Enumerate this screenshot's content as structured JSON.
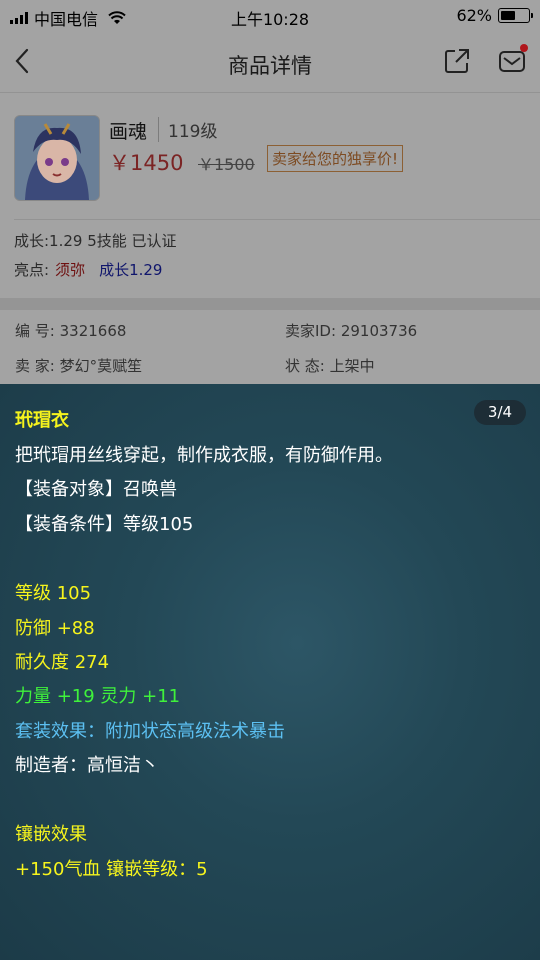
{
  "status_bar": {
    "carrier": "中国电信",
    "time": "上午10:28",
    "battery_percent": "62%",
    "battery_level": 0.62,
    "icons": [
      "signal-icon",
      "wifi-icon",
      "battery-icon"
    ]
  },
  "nav": {
    "title": "商品详情",
    "icons": [
      "back-icon",
      "share-icon",
      "mail-icon"
    ]
  },
  "product": {
    "name": "画魂",
    "level": "119级",
    "price": "￥1450",
    "old_price": "￥1500",
    "tag": "卖家给您的独享价!",
    "growth_line": "成长:1.29 5技能 已认证",
    "highlight_label": "亮点:",
    "highlight_1": "须弥",
    "highlight_2": "成长1.29"
  },
  "info": {
    "number_label": "编 号:",
    "number_value": "3321668",
    "seller_id_label": "卖家ID:",
    "seller_id_value": "29103736",
    "seller_label": "卖 家:",
    "seller_value": "梦幻°莫赋笙",
    "status_label": "状 态:",
    "status_value": "上架中"
  },
  "tooltip": {
    "pager": "3/4",
    "title": "玳瑁衣",
    "description": "把玳瑁用丝线穿起，制作成衣服，有防御作用。",
    "equip_target": "【装备对象】召唤兽",
    "equip_condition": "【装备条件】等级105",
    "level": "等级 105",
    "defense": "防御 +88",
    "durability": "耐久度 274",
    "attributes": "力量 +19 灵力 +11",
    "set_effect": "套装效果：附加状态高级法术暴击",
    "maker": "制造者：高恒洁丶",
    "inlay_title": "镶嵌效果",
    "inlay_detail": "+150气血 镶嵌等级：5",
    "colors": {
      "yellow": "#f6f41d",
      "white": "#ffffff",
      "green": "#3ff23b",
      "blue": "#5cc0f2",
      "background": "#234856"
    }
  },
  "colors": {
    "price_red": "#e23636",
    "highlight_red": "#c01010",
    "highlight_blue": "#2020c0"
  }
}
